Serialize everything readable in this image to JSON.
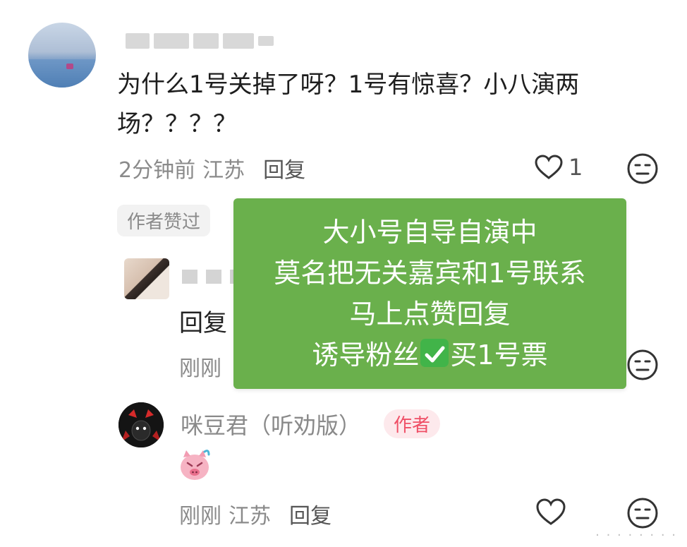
{
  "top_comment": {
    "text": "为什么1号关掉了呀？1号有惊喜？小八演两场？？？？",
    "time": "2分钟前",
    "location": "江苏",
    "reply_label": "回复",
    "like_count": "1",
    "author_liked_badge": "作者赞过"
  },
  "middle_reply": {
    "text_fragment": "回复",
    "time_fragment": "刚刚"
  },
  "overlay": {
    "background": "#6ab04c",
    "line1": "大小号自导自演中",
    "line2": "莫名把无关嘉宾和1号联系",
    "line3": "马上点赞回复",
    "line4_before": "诱导粉丝",
    "line4_after": "买1号票"
  },
  "author_reply": {
    "name": "咪豆君（听劝版）",
    "badge": "作者",
    "badge_color": "#ef4f66",
    "time": "刚刚",
    "location": "江苏",
    "reply_label": "回复"
  },
  "icons": {
    "like": "heart-outline-icon",
    "dislike": "neutral-face-icon",
    "check": "check-mark-icon",
    "sticker": "crying-pig-sticker-icon"
  }
}
